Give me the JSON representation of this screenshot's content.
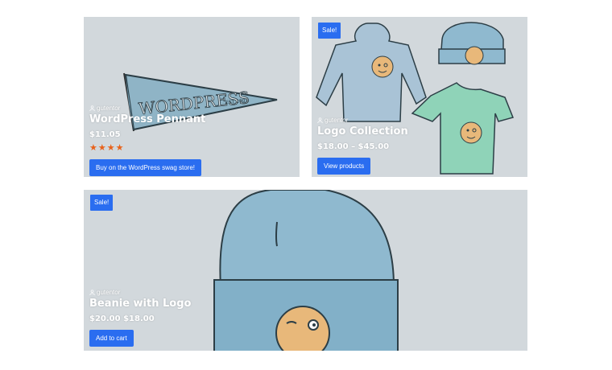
{
  "products": [
    {
      "title": "WordPress Pennant",
      "author": "gutentor",
      "price": "$11.05",
      "rating": 4,
      "button_label": "Buy on the WordPress swag store!",
      "sale_badge": ""
    },
    {
      "title": "Logo Collection",
      "author": "gutentor",
      "price": "$18.00 – $45.00",
      "button_label": "View products",
      "sale_badge": "Sale!"
    },
    {
      "title": "Beanie with Logo",
      "author": "gutentor",
      "price": "$20.00 $18.00",
      "button_label": "Add to cart",
      "sale_badge": "Sale!"
    }
  ],
  "icons": {
    "author": "user-icon",
    "rating": "star-icon"
  },
  "colors": {
    "card_bg": "#d2d8dc",
    "accent": "#2a6df0",
    "star": "#e8621a"
  }
}
